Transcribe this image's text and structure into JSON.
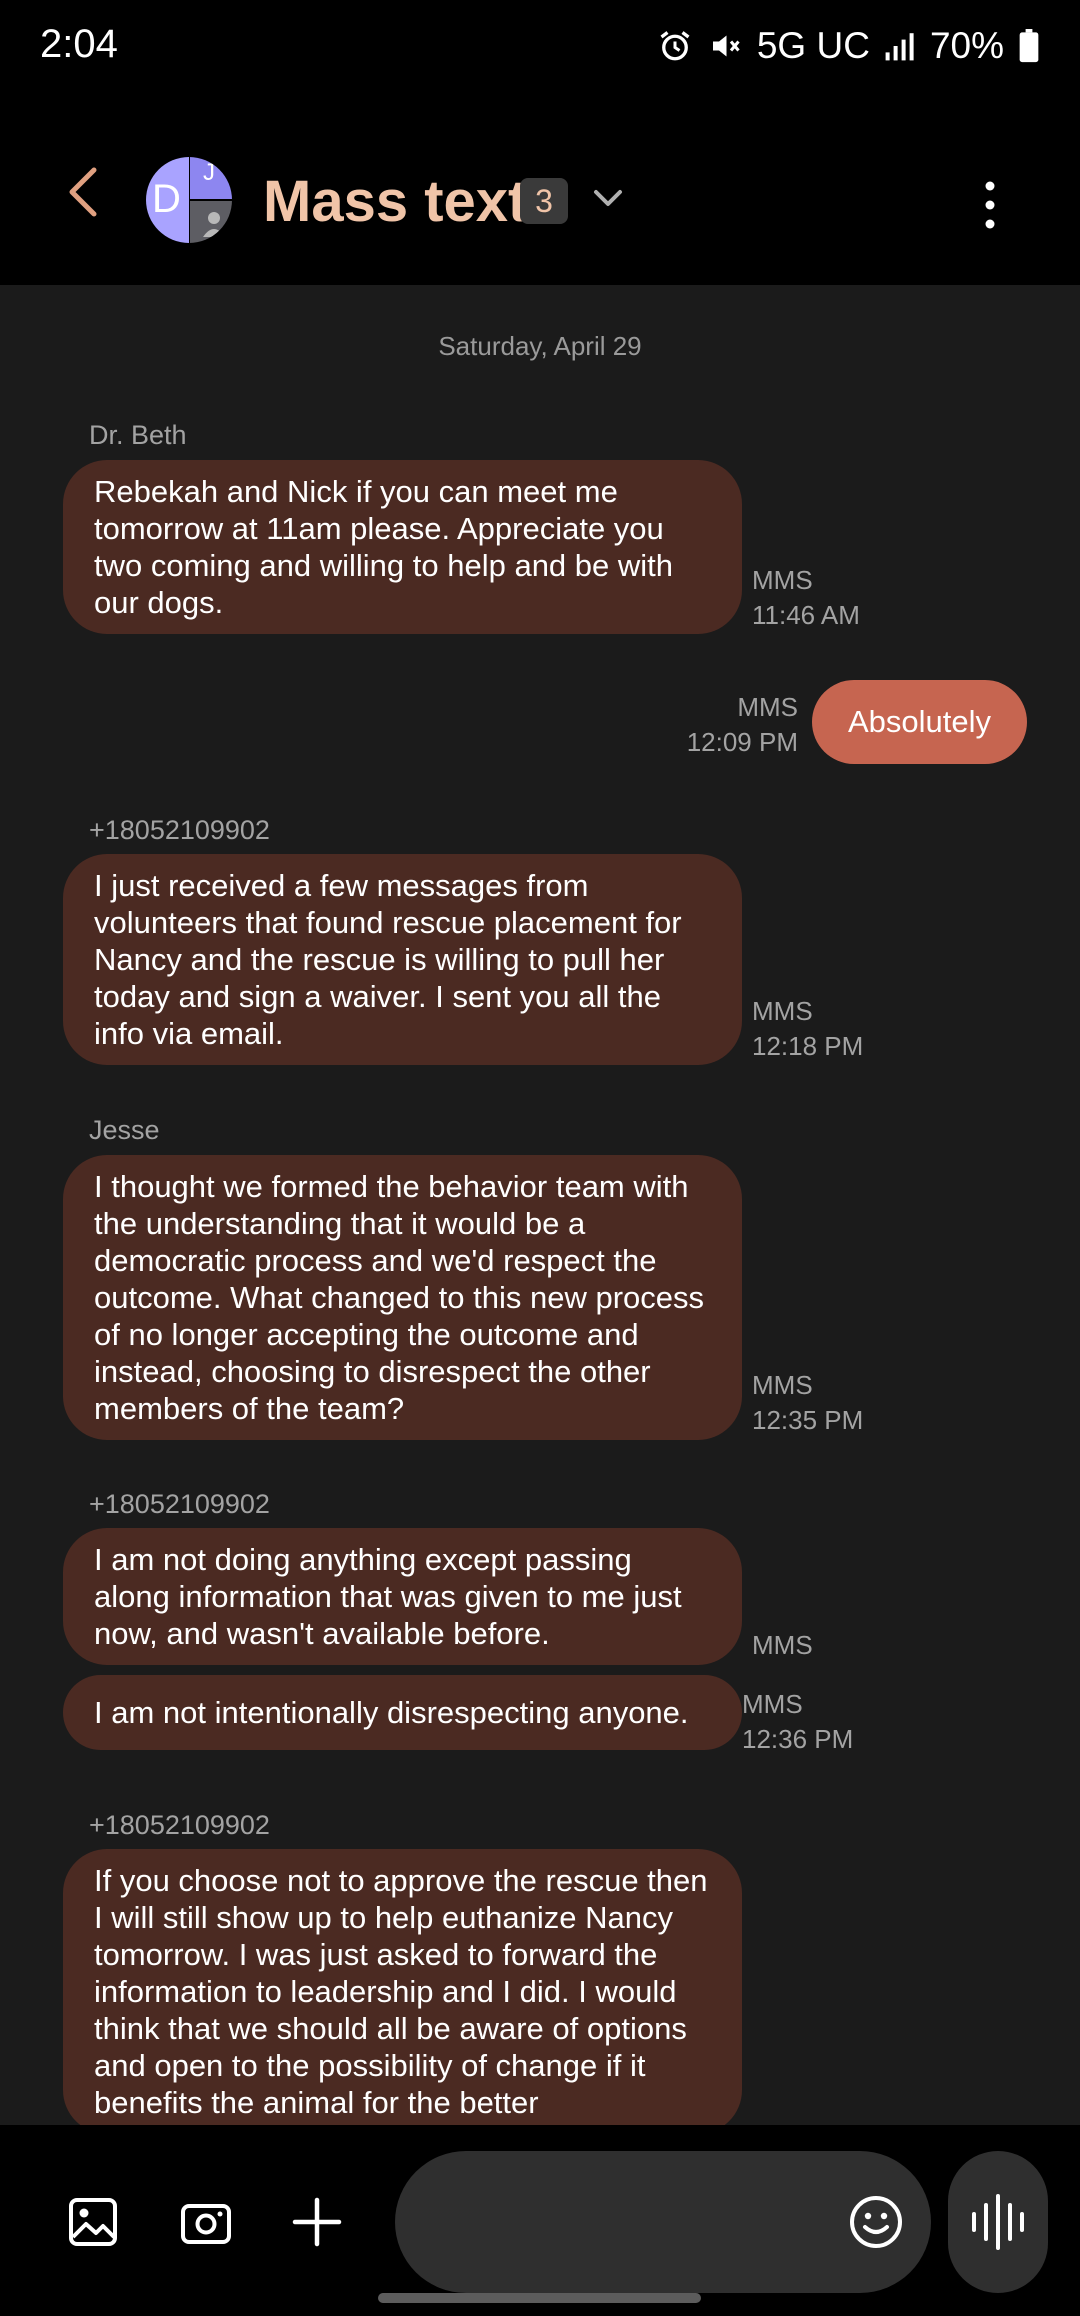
{
  "status_bar": {
    "time": "2:04",
    "network": "5G UC",
    "battery": "70%"
  },
  "header": {
    "avatar_letter_1": "D",
    "avatar_letter_2": "J",
    "title": "Mass text",
    "member_count": "3"
  },
  "date_separator": "Saturday, April 29",
  "messages": [
    {
      "sender": "Dr. Beth",
      "text": "Rebekah and Nick if you can meet me tomorrow at 11am please. Appreciate you two coming and willing to help and be with our dogs.",
      "type": "MMS",
      "time": "11:46 AM"
    },
    {
      "outgoing": true,
      "text": "Absolutely",
      "type": "MMS",
      "time": "12:09 PM"
    },
    {
      "sender": "+18052109902",
      "text": "I just received a few messages from volunteers that found rescue placement for Nancy and the rescue is willing to pull her today and sign a waiver. I sent you all the info via email.",
      "type": "MMS",
      "time": "12:18 PM"
    },
    {
      "sender": "Jesse",
      "text": "I thought we formed the behavior team with the understanding that it would be a democratic process and we'd respect the outcome. What changed to this new process of no longer accepting the outcome and instead, choosing to disrespect the other members of the team?",
      "type": "MMS",
      "time": "12:35 PM"
    },
    {
      "sender": "+18052109902",
      "text": "I am not doing anything except passing along information that was given to me just now, and wasn't available before.",
      "type": "MMS"
    },
    {
      "text": "I am not intentionally disrespecting anyone.",
      "type": "MMS",
      "time": "12:36 PM"
    },
    {
      "sender": "+18052109902",
      "text": "If you choose not to approve the rescue then I will still show up to help euthanize Nancy tomorrow. I was just asked to forward the information to leadership and I did. I would think that we should all be aware of options and open to the possibility of change if it benefits the animal for the better"
    }
  ],
  "icons": {
    "back": "chevron-left-icon",
    "more": "more-vertical-icon",
    "gallery": "gallery-icon",
    "camera": "camera-icon",
    "attach": "plus-icon",
    "emoji": "emoji-icon",
    "voice": "voice-wave-icon"
  },
  "colors": {
    "incoming_bubble": "#4b2a22",
    "outgoing_bubble": "#c66550",
    "title": "#f0c4a8",
    "chat_background": "#1b1b1b"
  }
}
